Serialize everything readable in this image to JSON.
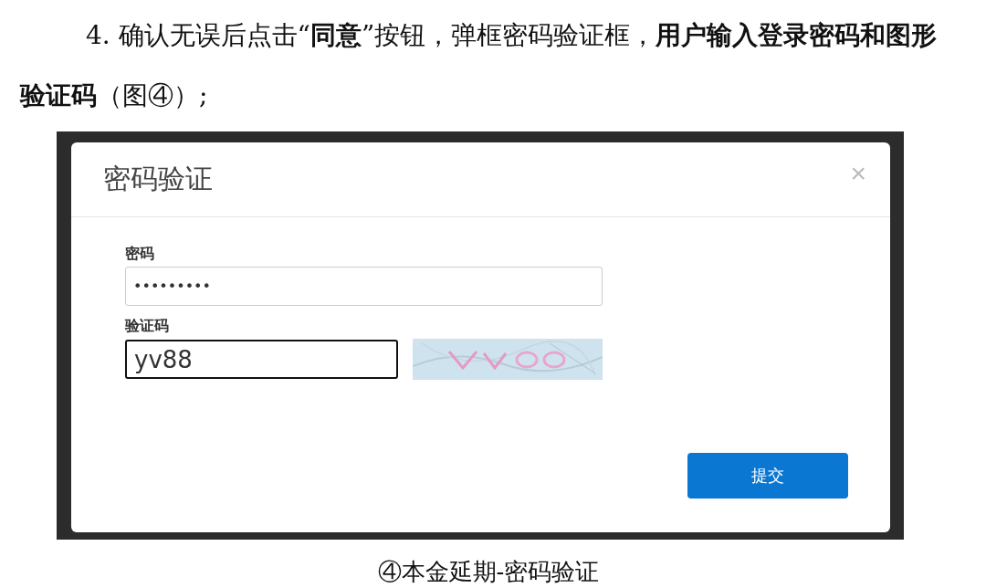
{
  "document": {
    "paragraph": "4. 确认无误后点击“**同意**”按钮，弹框密码验证框，**用户输入登录密码和图形验证码**（图④）;",
    "caption": "④本金延期-密码验证"
  },
  "dialog": {
    "title": "密码验证",
    "close": "×",
    "fields": [
      {
        "label": "密码",
        "value": "•••••••••",
        "focused": false,
        "kind": "plain"
      },
      {
        "label": "验证码",
        "value": "yv88",
        "focused": true,
        "kind": "captcha"
      }
    ],
    "submit_button": "提交"
  }
}
